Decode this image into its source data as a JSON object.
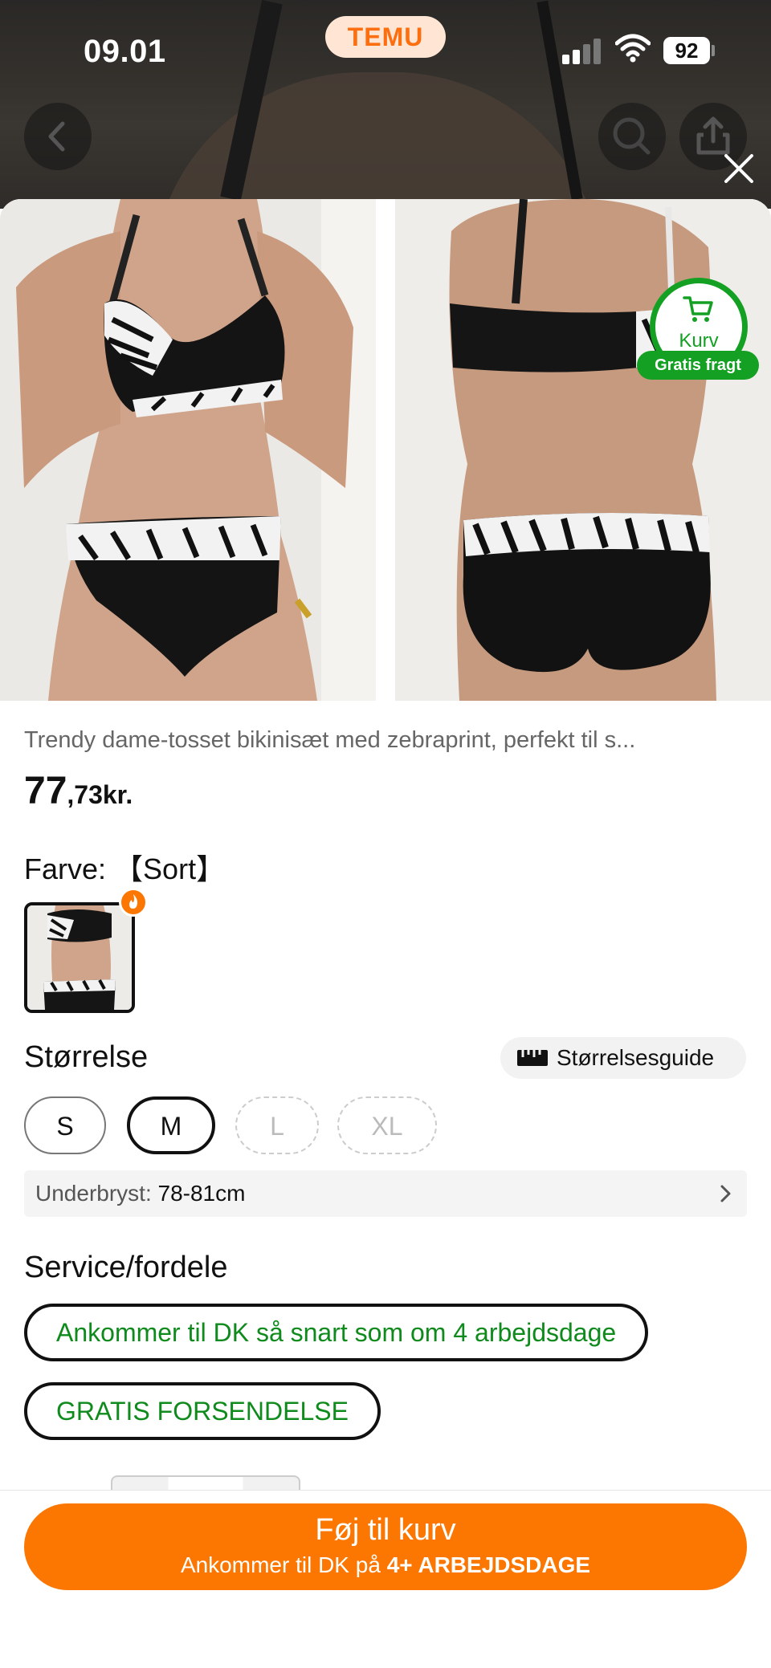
{
  "status_bar": {
    "time": "09.01",
    "battery": "92"
  },
  "header": {
    "brand": "TEMU"
  },
  "cart_badge": {
    "label": "Kurv",
    "free_shipping": "Gratis fragt"
  },
  "product": {
    "title": "Trendy dame-tosset bikinisæt med zebraprint, perfekt til s...",
    "price_main": "77",
    "price_rest": ",73kr."
  },
  "color": {
    "label": "Farve:",
    "value": "【Sort】"
  },
  "size": {
    "label": "Størrelse",
    "guide": "Størrelsesguide",
    "options": [
      {
        "label": "S",
        "state": "available"
      },
      {
        "label": "M",
        "state": "selected"
      },
      {
        "label": "L",
        "state": "disabled"
      },
      {
        "label": "XL",
        "state": "disabled"
      }
    ],
    "underbust_label": "Underbryst:",
    "underbust_value": "78-81cm"
  },
  "service": {
    "label": "Service/fordele",
    "items": [
      "Ankommer til DK så snart som om 4 arbejdsdage",
      "GRATIS FORSENDELSE"
    ]
  },
  "cta": {
    "label": "Føj til kurv",
    "sub_prefix": "Ankommer til DK på ",
    "sub_bold": "4+ ARBEJDSDAGE"
  },
  "colors": {
    "accent": "#fb7701",
    "green": "#13a023"
  }
}
